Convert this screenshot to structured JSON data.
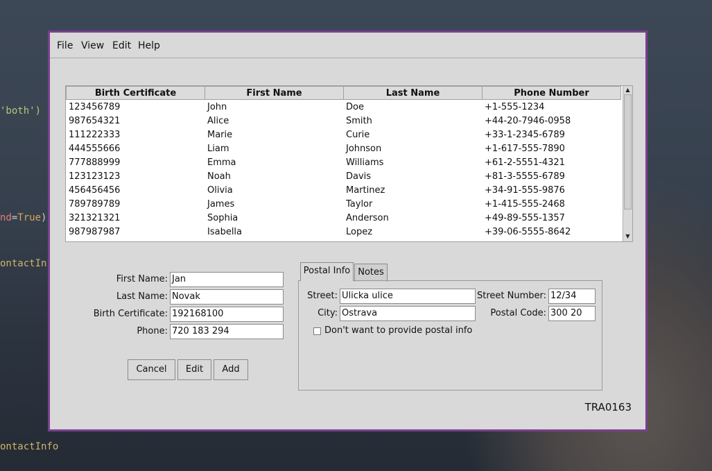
{
  "background": {
    "code_fragments": [
      "'both')",
      "nd=True)",
      "ontactIn",
      "ontactInfo"
    ]
  },
  "menu": [
    "File",
    "View",
    "Edit",
    "Help"
  ],
  "table": {
    "columns": [
      "Birth Certificate",
      "First Name",
      "Last Name",
      "Phone Number"
    ],
    "rows": [
      [
        "123456789",
        "John",
        "Doe",
        "+1-555-1234"
      ],
      [
        "987654321",
        "Alice",
        "Smith",
        "+44-20-7946-0958"
      ],
      [
        "111222333",
        "Marie",
        "Curie",
        "+33-1-2345-6789"
      ],
      [
        "444555666",
        "Liam",
        "Johnson",
        "+1-617-555-7890"
      ],
      [
        "777888999",
        "Emma",
        "Williams",
        "+61-2-5551-4321"
      ],
      [
        "123123123",
        "Noah",
        "Davis",
        "+81-3-5555-6789"
      ],
      [
        "456456456",
        "Olivia",
        "Martinez",
        "+34-91-555-9876"
      ],
      [
        "789789789",
        "James",
        "Taylor",
        "+1-415-555-2468"
      ],
      [
        "321321321",
        "Sophia",
        "Anderson",
        "+49-89-555-1357"
      ],
      [
        "987987987",
        "Isabella",
        "Lopez",
        "+39-06-5555-8642"
      ]
    ]
  },
  "form": {
    "first_name_label": "First Name:",
    "first_name_value": "Jan",
    "last_name_label": "Last Name:",
    "last_name_value": "Novak",
    "birth_cert_label": "Birth Certificate:",
    "birth_cert_value": "192168100",
    "phone_label": "Phone:",
    "phone_value": "720 183 294"
  },
  "buttons": {
    "cancel": "Cancel",
    "edit": "Edit",
    "add": "Add"
  },
  "tabs": {
    "postal": "Postal Info",
    "notes": "Notes",
    "active": "Postal Info"
  },
  "postal": {
    "street_label": "Street:",
    "street_value": "Ulicka ulice",
    "street_number_label": "Street Number:",
    "street_number_value": "12/34",
    "city_label": "City:",
    "city_value": "Ostrava",
    "postal_code_label": "Postal Code:",
    "postal_code_value": "300 20",
    "opt_out_label": "Don't want to provide postal info",
    "opt_out_checked": false
  },
  "status_code": "TRA0163",
  "colors": {
    "window_border": "#7b3f8e",
    "window_bg": "#d9d9d9"
  }
}
